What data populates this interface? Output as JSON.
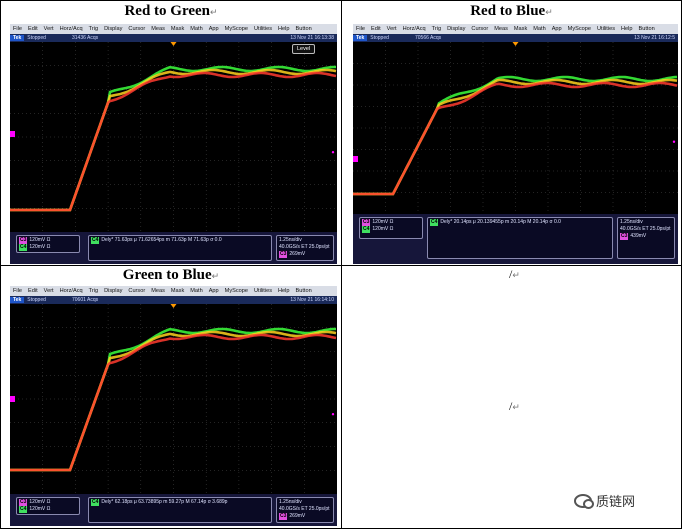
{
  "cells": [
    {
      "title": "Red to Green",
      "menu": [
        "File",
        "Edit",
        "Vert",
        "Horz/Acq",
        "Trig",
        "Display",
        "Cursor",
        "Meas",
        "Mask",
        "Math",
        "App",
        "MyScope",
        "Utilities",
        "Help",
        "Button"
      ],
      "status": "Stopped",
      "acqs": "31436 Acqs",
      "date": "13 Nov 21 16:13:38",
      "level_label": "Level",
      "ch3": "120mV Ω",
      "ch4": "120mV Ω",
      "meas_tag": "C4  C3",
      "meas": "Dely* 71.63ps  μ 71.62654ps  m 71.63p  M 71.63p  σ 0.0",
      "timebase": "1.25ns/div",
      "sampling": "40.0GS/s ET 25.0ps/pt",
      "trig_val": "269mV",
      "trig_ch": "C3"
    },
    {
      "title": "Red to Blue",
      "menu": [
        "File",
        "Edit",
        "Vert",
        "Horz/Acq",
        "Trig",
        "Display",
        "Cursor",
        "Meas",
        "Mask",
        "Math",
        "App",
        "MyScope",
        "Utilities",
        "Help",
        "Button"
      ],
      "status": "Stopped",
      "acqs": "70566 Acqs",
      "date": "13 Nov 21 16:12:5",
      "level_label": "",
      "ch3": "120mV Ω",
      "ch4": "120mV Ω",
      "meas_tag": "C4  C3",
      "meas": "Dely* 20.14ps  μ 20.139455p  m 20.14p  M 20.14p  σ 0.0",
      "timebase": "1.25ns/div",
      "sampling": "40.0GS/s ET 25.0ps/pt",
      "trig_val": "439mV",
      "trig_ch": "C3"
    },
    {
      "title": "Green to Blue",
      "menu": [
        "File",
        "Edit",
        "Vert",
        "Horz/Acq",
        "Trig",
        "Display",
        "Cursor",
        "Meas",
        "Mask",
        "Math",
        "App",
        "MyScope",
        "Utilities",
        "Help",
        "Button"
      ],
      "status": "Stopped",
      "acqs": "70601 Acqs",
      "date": "13 Nov 21 16:14:10",
      "level_label": "",
      "ch3": "120mV Ω",
      "ch4": "120mV Ω",
      "meas_tag": "C4  C3",
      "meas": "Dely* 62.18ps  μ 63.73895p  m 59.27p  M 67.14p  σ 3.689p",
      "timebase": "1.25ns/div",
      "sampling": "40.0GS/s ET 25.0ps/pt",
      "trig_val": "269mV",
      "trig_ch": "C3"
    }
  ],
  "empty_cell_text": "/",
  "empty_cell_center_text": "/",
  "return_mark": "↵",
  "watermark": "质链网",
  "colors": {
    "trace_red": "#ff3b2f",
    "trace_green": "#3cff3c",
    "trace_yellow": "#ffd21e",
    "grid": "#5a5a5a"
  }
}
